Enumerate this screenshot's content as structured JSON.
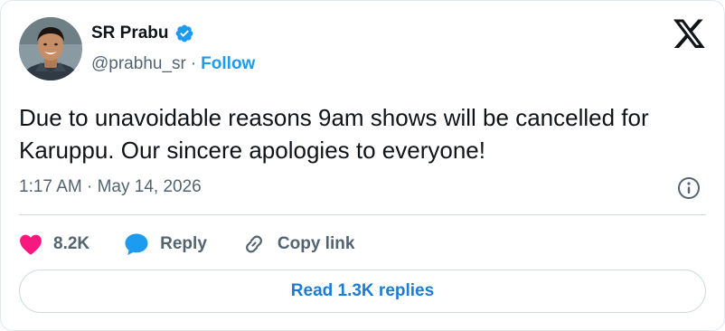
{
  "author": {
    "display_name": "SR Prabu",
    "handle": "@prabhu_sr",
    "separator": "·",
    "follow_label": "Follow",
    "verified": true,
    "avatar_icon": "user-avatar"
  },
  "brand": {
    "logo_icon": "x-logo-icon"
  },
  "tweet": {
    "text": "Due to unavoidable reasons 9am shows will be cancelled for Karuppu. Our sincere apologies to everyone!",
    "timestamp": "1:17 AM · May 14, 2026",
    "info_icon": "info-icon"
  },
  "actions": {
    "like_count": "8.2K",
    "like_icon": "heart-icon",
    "reply_label": "Reply",
    "reply_icon": "reply-bubble-icon",
    "copy_label": "Copy link",
    "copy_icon": "link-icon"
  },
  "replies": {
    "button_label": "Read 1.3K replies"
  },
  "colors": {
    "accent": "#1d9bf0",
    "like": "#f91880",
    "text_primary": "#0f1419",
    "text_secondary": "#536471",
    "border": "#cfd9de"
  }
}
